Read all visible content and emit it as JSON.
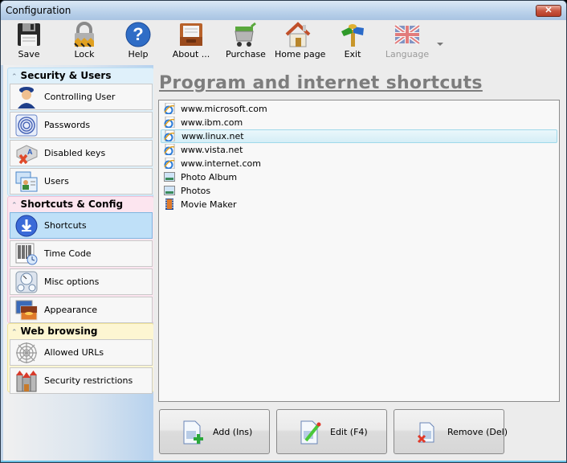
{
  "window": {
    "title": "Configuration",
    "close_label": "✕"
  },
  "toolbar": {
    "items": [
      {
        "label": "Save",
        "icon": "floppy-disk-icon",
        "enabled": true
      },
      {
        "label": "Lock",
        "icon": "padlock-icon",
        "enabled": true
      },
      {
        "label": "Help",
        "icon": "help-question-icon",
        "enabled": true
      },
      {
        "label": "About ...",
        "icon": "inbox-tray-icon",
        "enabled": true
      },
      {
        "label": "Purchase",
        "icon": "shopping-cart-icon",
        "enabled": true
      },
      {
        "label": "Home page",
        "icon": "house-icon",
        "enabled": true
      },
      {
        "label": "Exit",
        "icon": "signpost-icon",
        "enabled": true
      },
      {
        "label": "Language",
        "icon": "uk-flag-icon",
        "enabled": false
      }
    ]
  },
  "sidebar": {
    "groups": [
      {
        "title": "Security & Users",
        "items": [
          {
            "label": "Controlling User",
            "icon": "police-user-icon"
          },
          {
            "label": "Passwords",
            "icon": "fingerprint-icon"
          },
          {
            "label": "Disabled keys",
            "icon": "disabled-key-icon"
          },
          {
            "label": "Users",
            "icon": "user-cards-icon"
          }
        ]
      },
      {
        "title": "Shortcuts & Config",
        "items": [
          {
            "label": "Shortcuts",
            "icon": "download-arrow-icon",
            "active": true
          },
          {
            "label": "Time Code",
            "icon": "barcode-clock-icon"
          },
          {
            "label": "Misc options",
            "icon": "gauges-icon"
          },
          {
            "label": "Appearance",
            "icon": "pictures-icon"
          }
        ]
      },
      {
        "title": "Web browsing",
        "items": [
          {
            "label": "Allowed URLs",
            "icon": "spider-web-icon"
          },
          {
            "label": "Security restrictions",
            "icon": "castle-icon"
          }
        ]
      }
    ]
  },
  "main": {
    "title": "Program and internet shortcuts",
    "shortcuts": [
      {
        "label": "www.microsoft.com",
        "icon": "ie-shortcut-icon"
      },
      {
        "label": "www.ibm.com",
        "icon": "ie-shortcut-icon"
      },
      {
        "label": "www.linux.net",
        "icon": "ie-shortcut-icon",
        "selected": true
      },
      {
        "label": "www.vista.net",
        "icon": "ie-shortcut-icon"
      },
      {
        "label": "www.internet.com",
        "icon": "ie-shortcut-icon"
      },
      {
        "label": "Photo Album",
        "icon": "photo-icon"
      },
      {
        "label": "Photos",
        "icon": "photo-icon"
      },
      {
        "label": "Movie Maker",
        "icon": "film-strip-icon"
      }
    ],
    "buttons": {
      "add": "Add (Ins)",
      "edit": "Edit (F4)",
      "remove": "Remove (Del)"
    }
  },
  "colors": {
    "title_gray": "#7d7d7d",
    "selection_border": "#9fd9ea",
    "active_nav": "#bfe0f8",
    "group_security": "#dff0fa",
    "group_shortcuts": "#fce5ef",
    "group_web": "#fdf6d2"
  }
}
